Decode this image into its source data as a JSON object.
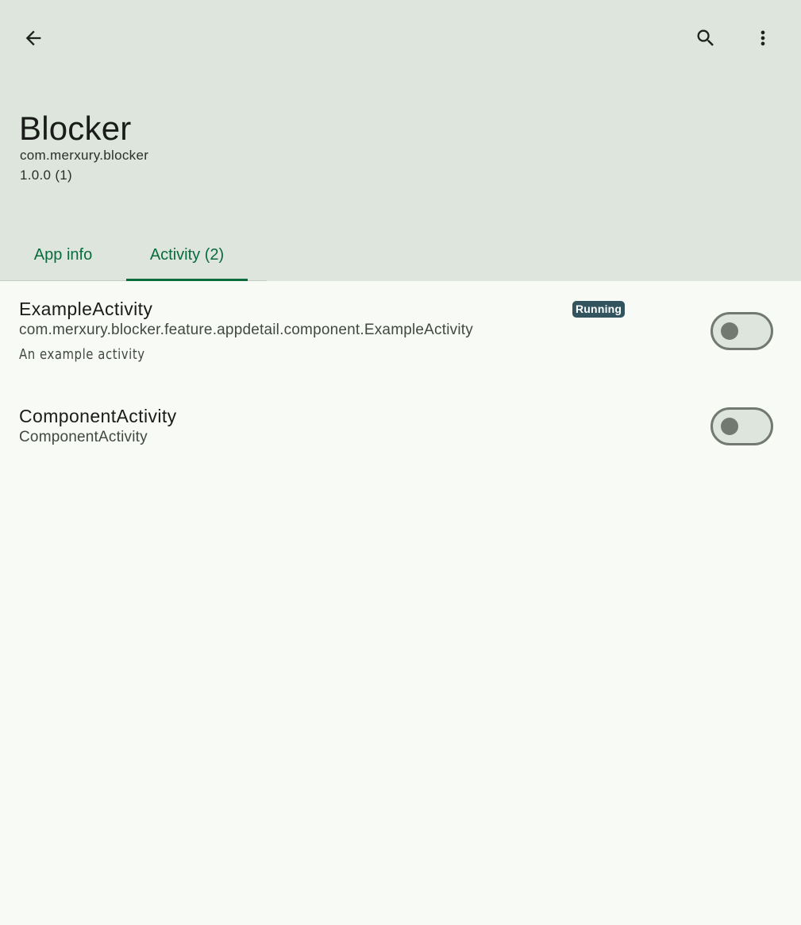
{
  "toolbar": {
    "back_icon": "arrow-back-icon",
    "search_icon": "search-icon",
    "more_icon": "more-vert-icon"
  },
  "app": {
    "title": "Blocker",
    "package": "com.merxury.blocker",
    "version": "1.0.0 (1)"
  },
  "tabs": [
    {
      "label": "App info",
      "selected": false
    },
    {
      "label": "Activity (2)",
      "selected": true
    }
  ],
  "components": [
    {
      "name": "ExampleActivity",
      "class_name": "com.merxury.blocker.feature.appdetail.component.ExampleActivity",
      "description": "An example activity",
      "badge": "Running",
      "enabled": false
    },
    {
      "name": "ComponentActivity",
      "class_name": "ComponentActivity",
      "enabled": false
    }
  ],
  "colors": {
    "header_bg": "#dde5dc",
    "body_bg": "#f8faf5",
    "accent": "#0a6b3d",
    "badge_bg": "#32545f"
  }
}
